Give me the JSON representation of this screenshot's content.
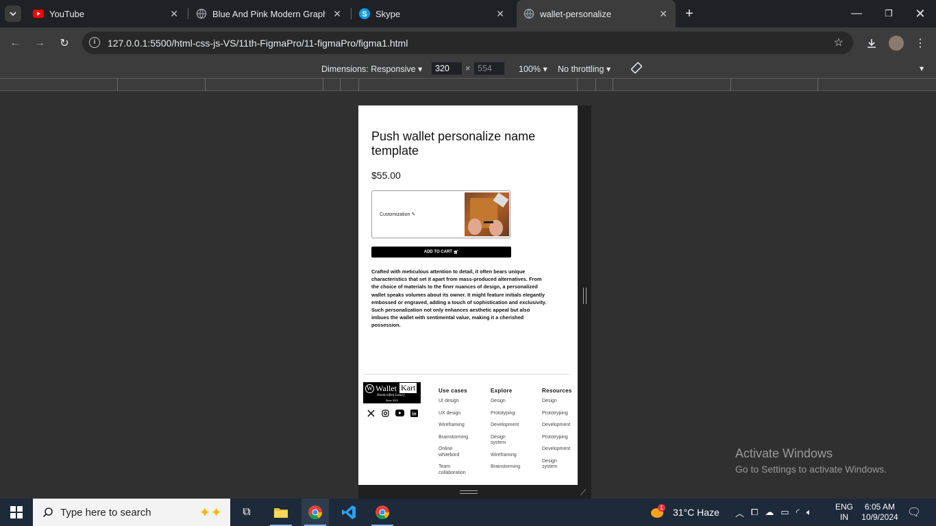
{
  "tabs": [
    {
      "title": "YouTube"
    },
    {
      "title": "Blue And Pink Modern Graphic"
    },
    {
      "title": "Skype"
    },
    {
      "title": "wallet-personalize"
    }
  ],
  "toolbar": {
    "url": "127.0.0.1:5500/html-css-js-VS/11th-FigmaPro/11-figmaPro/figma1.html"
  },
  "devtools": {
    "dimensions": "Dimensions: Responsive",
    "width": "320",
    "height": "554",
    "times": "×",
    "zoom": "100%",
    "throttling": "No throttling"
  },
  "page": {
    "title": "Push wallet personalize name template",
    "price": "$55.00",
    "customization": "Customization",
    "add_to_cart": "ADD TO CART",
    "description": "Crafted with meticulous attention to detail, it often bears unique characteristics that set it apart from mass-produced alternatives. From the choice of materials to the finer nuances of design, a personalized wallet speaks volumes about its owner. It might feature initials elegantly embossed or engraved, adding a touch of sophistication and exclusivity. Such personalization not only enhances aesthetic appeal but also imbues the wallet with sentimental value, making it a cherished possession.",
    "logo": {
      "text1": "Wallet",
      "text2": "Kart",
      "tagline": "Handcrafted Luxury",
      "since": "Since 2023"
    },
    "footer": [
      {
        "heading": "Use cases",
        "links": [
          "UI design",
          "UX design",
          "Wireframing",
          "Brainstorming",
          "Online whitebord",
          "Team collaboration"
        ]
      },
      {
        "heading": "Explore",
        "links": [
          "Design",
          "Prototyping",
          "Development",
          "Design system",
          "Wireframing",
          "Brainstorming"
        ]
      },
      {
        "heading": "Resources",
        "links": [
          "Design",
          "Prototryping",
          "Development",
          "Prototryping",
          "Development",
          "Design system"
        ]
      }
    ]
  },
  "activation": {
    "line1": "Activate Windows",
    "line2": "Go to Settings to activate Windows."
  },
  "taskbar": {
    "search_placeholder": "Type here to search",
    "weather": "31°C  Haze",
    "weather_badge": "1",
    "lang1": "ENG",
    "lang2": "IN",
    "time": "6:05 AM",
    "date": "10/9/2024"
  },
  "colors": {
    "browser_bg": "#202124",
    "toolbar": "#3c3c3c",
    "taskbar": "#1c2a3a",
    "cart_button": "#000000"
  }
}
